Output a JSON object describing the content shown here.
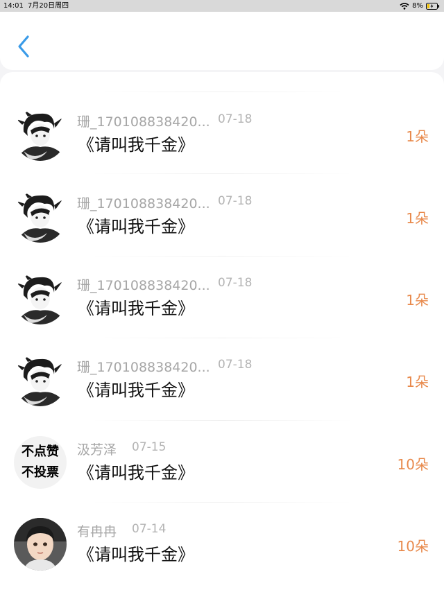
{
  "status_bar": {
    "time": "14:01",
    "date": "7月20日周四",
    "battery": "8%"
  },
  "nav": {
    "back_icon": "chevron-left-icon"
  },
  "colors": {
    "accent_blue": "#3a9be8",
    "amount_orange": "#e8894b"
  },
  "records": [
    {
      "user": "珊_170108838420...",
      "date": "07-18",
      "book": "《请叫我千金》",
      "amount": "1朵",
      "avatar": "anime-boy"
    },
    {
      "user": "珊_170108838420...",
      "date": "07-18",
      "book": "《请叫我千金》",
      "amount": "1朵",
      "avatar": "anime-boy"
    },
    {
      "user": "珊_170108838420...",
      "date": "07-18",
      "book": "《请叫我千金》",
      "amount": "1朵",
      "avatar": "anime-boy"
    },
    {
      "user": "珊_170108838420...",
      "date": "07-18",
      "book": "《请叫我千金》",
      "amount": "1朵",
      "avatar": "anime-boy"
    },
    {
      "user": "汲芳泽",
      "date": "07-15",
      "book": "《请叫我千金》",
      "amount": "10朵",
      "avatar": "text",
      "avatar_lines": [
        "不点赞",
        "不投票"
      ]
    },
    {
      "user": "有冉冉",
      "date": "07-14",
      "book": "《请叫我千金》",
      "amount": "10朵",
      "avatar": "child-photo"
    }
  ]
}
